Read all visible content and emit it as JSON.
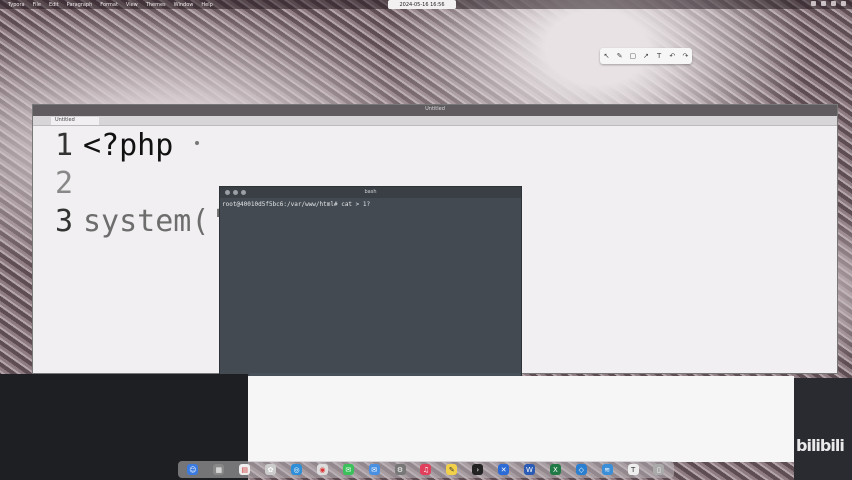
{
  "menubar": {
    "items": [
      "Typora",
      "File",
      "Edit",
      "Paragraph",
      "Format",
      "View",
      "Themes",
      "Window",
      "Help"
    ],
    "clock": "2024-05-16 16:56"
  },
  "editor": {
    "window_title": "Untitled",
    "tab_label": "Untitled",
    "lines": [
      {
        "number": "1",
        "text": "<?php"
      },
      {
        "number": "2",
        "text": ""
      },
      {
        "number": "3",
        "text": "system('whoami');"
      }
    ]
  },
  "terminal": {
    "title": "bash",
    "prompt_line": "root@40010d5f5bc6:/var/www/html# cat > 1?"
  },
  "watermark": "bilibili",
  "annotation_toolbar": {
    "icons": [
      "select-icon",
      "pen-icon",
      "shape-icon",
      "arrow-icon",
      "text-icon",
      "undo-icon",
      "redo-icon"
    ]
  },
  "dock": {
    "apps": [
      "finder-icon",
      "launchpad-icon",
      "calendar-icon",
      "photos-icon",
      "safari-icon",
      "chrome-icon",
      "messages-icon",
      "mail-icon",
      "settings-icon",
      "music-icon",
      "notes-icon",
      "terminal-icon",
      "xcode-icon",
      "word-icon",
      "excel-icon",
      "vscode-icon",
      "docker-icon",
      "typora-icon",
      "trash-icon"
    ]
  },
  "colors": {
    "terminal_bg": "#434a52",
    "editor_bg": "#f1eff1"
  }
}
